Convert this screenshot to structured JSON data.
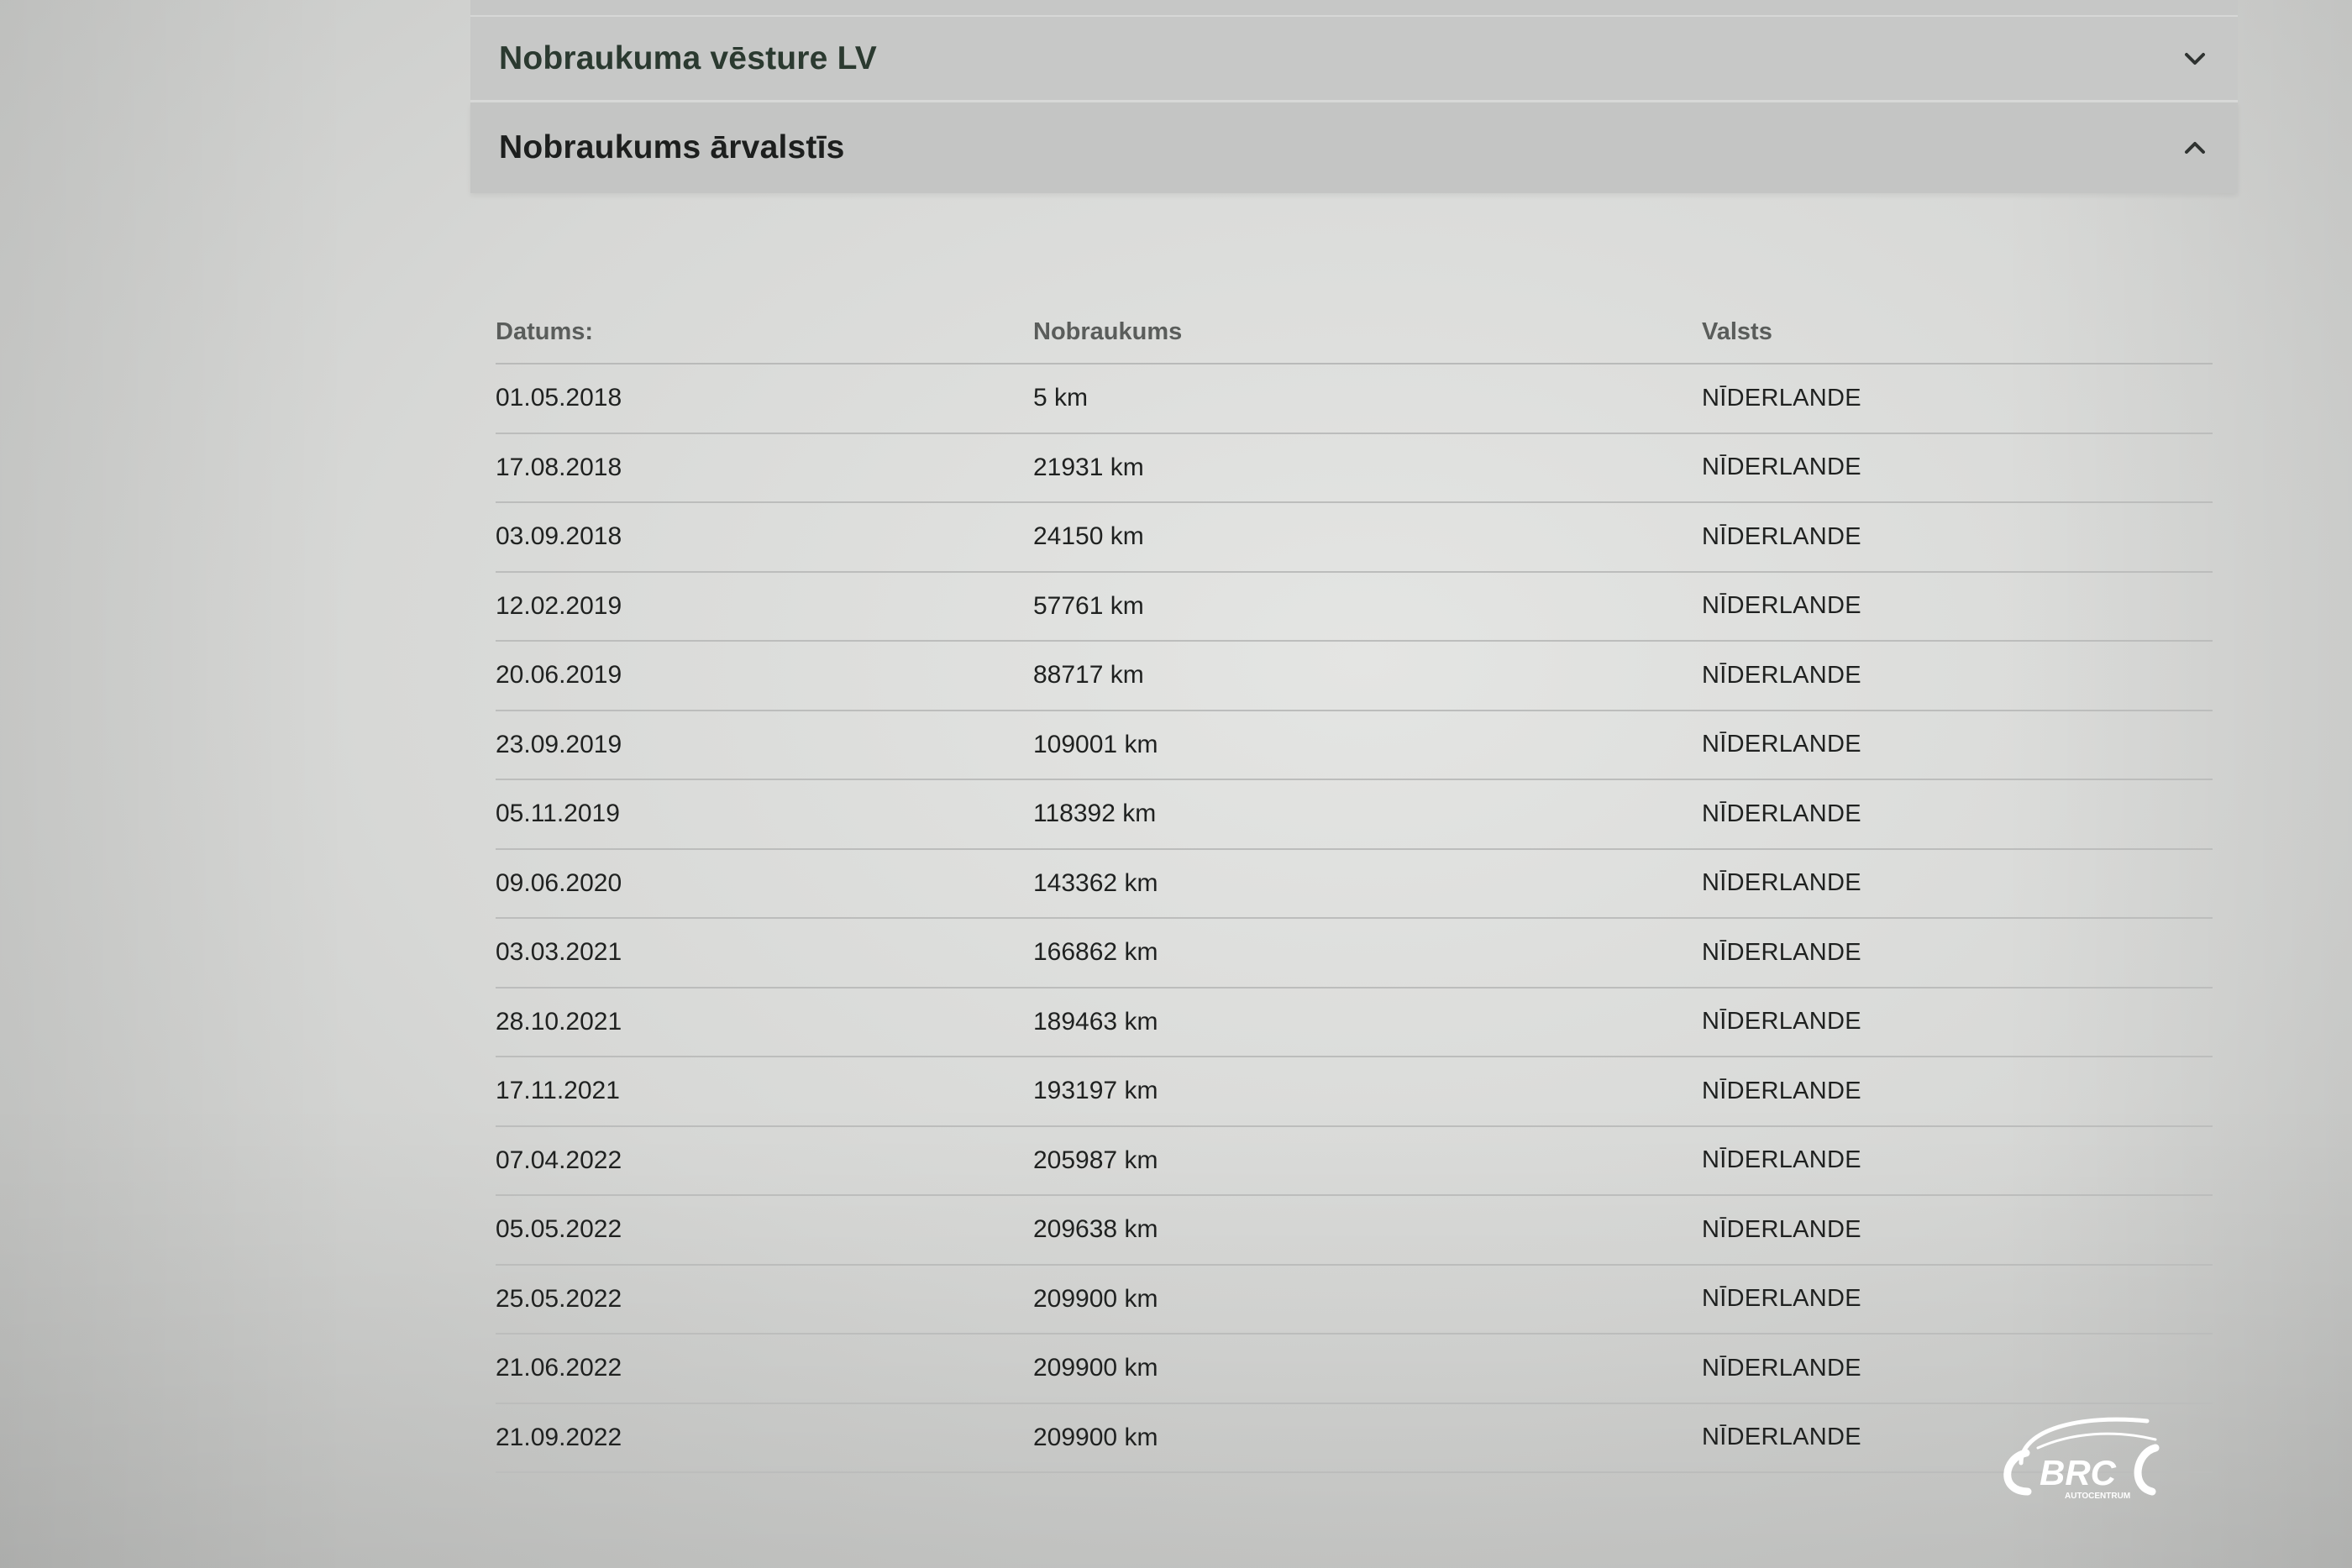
{
  "accordion": {
    "sections": [
      {
        "title": "Nobraukuma vēsture LV",
        "state": "collapsed",
        "icon": "chevron-down-icon"
      },
      {
        "title": "Nobraukums ārvalstīs",
        "state": "expanded",
        "icon": "chevron-up-icon"
      }
    ]
  },
  "table": {
    "headers": {
      "date": "Datums:",
      "mileage": "Nobraukums",
      "country": "Valsts"
    },
    "rows": [
      {
        "date": "01.05.2018",
        "mileage": "5 km",
        "country": "NĪDERLANDE"
      },
      {
        "date": "17.08.2018",
        "mileage": "21931 km",
        "country": "NĪDERLANDE"
      },
      {
        "date": "03.09.2018",
        "mileage": "24150 km",
        "country": "NĪDERLANDE"
      },
      {
        "date": "12.02.2019",
        "mileage": "57761 km",
        "country": "NĪDERLANDE"
      },
      {
        "date": "20.06.2019",
        "mileage": "88717 km",
        "country": "NĪDERLANDE"
      },
      {
        "date": "23.09.2019",
        "mileage": "109001 km",
        "country": "NĪDERLANDE"
      },
      {
        "date": "05.11.2019",
        "mileage": "118392 km",
        "country": "NĪDERLANDE"
      },
      {
        "date": "09.06.2020",
        "mileage": "143362 km",
        "country": "NĪDERLANDE"
      },
      {
        "date": "03.03.2021",
        "mileage": "166862 km",
        "country": "NĪDERLANDE"
      },
      {
        "date": "28.10.2021",
        "mileage": "189463 km",
        "country": "NĪDERLANDE"
      },
      {
        "date": "17.11.2021",
        "mileage": "193197 km",
        "country": "NĪDERLANDE"
      },
      {
        "date": "07.04.2022",
        "mileage": "205987 km",
        "country": "NĪDERLANDE"
      },
      {
        "date": "05.05.2022",
        "mileage": "209638 km",
        "country": "NĪDERLANDE"
      },
      {
        "date": "25.05.2022",
        "mileage": "209900 km",
        "country": "NĪDERLANDE"
      },
      {
        "date": "21.06.2022",
        "mileage": "209900 km",
        "country": "NĪDERLANDE"
      },
      {
        "date": "21.09.2022",
        "mileage": "209900 km",
        "country": "NĪDERLANDE"
      }
    ]
  },
  "watermark": {
    "brand": "BRC",
    "subtitle": "AUTOCENTRUM"
  },
  "colors": {
    "accent_title": "#2b3a30",
    "header_bg": "#c7c8c7",
    "text": "#1f2120"
  }
}
